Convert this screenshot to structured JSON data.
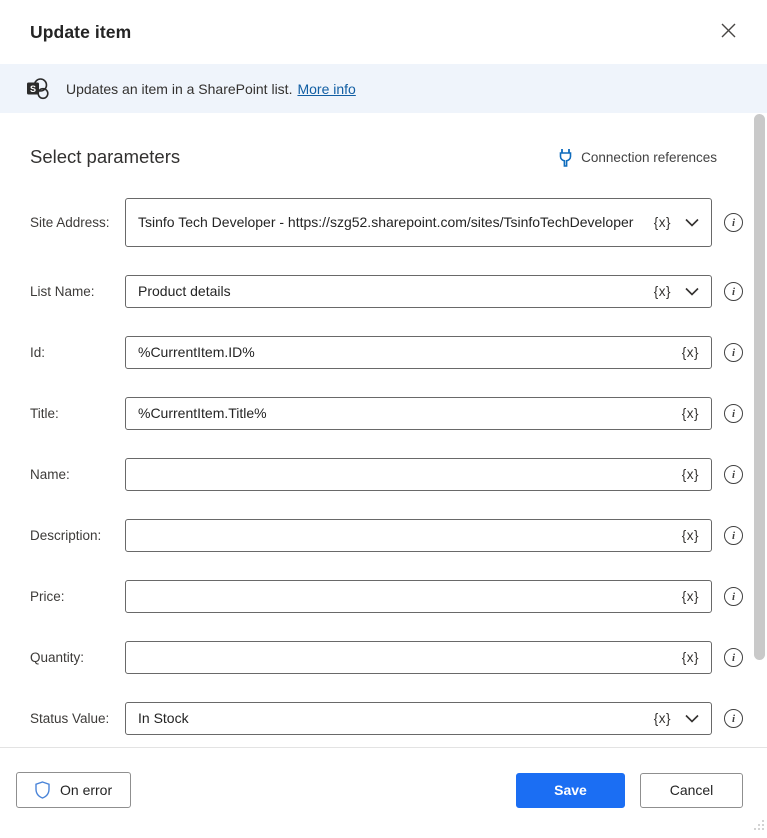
{
  "dialog": {
    "title": "Update item"
  },
  "info_bar": {
    "text": "Updates an item in a SharePoint list.",
    "link_label": "More info",
    "icon": "sharepoint-icon"
  },
  "parameters": {
    "heading": "Select parameters",
    "connection_references_label": "Connection references",
    "connection_references_icon": "plug-icon"
  },
  "variable_token": "{x}",
  "fields": [
    {
      "id": "site-address",
      "label": "Site Address:",
      "value": "Tsinfo Tech Developer - https://szg52.sharepoint.com/sites/TsinfoTechDeveloper",
      "has_dropdown": true,
      "multiline": true
    },
    {
      "id": "list-name",
      "label": "List Name:",
      "value": "Product details",
      "has_dropdown": true,
      "multiline": false
    },
    {
      "id": "id",
      "label": "Id:",
      "value": "%CurrentItem.ID%",
      "has_dropdown": false,
      "multiline": false
    },
    {
      "id": "title",
      "label": "Title:",
      "value": "%CurrentItem.Title%",
      "has_dropdown": false,
      "multiline": false
    },
    {
      "id": "name",
      "label": "Name:",
      "value": "",
      "has_dropdown": false,
      "multiline": false
    },
    {
      "id": "description",
      "label": "Description:",
      "value": "",
      "has_dropdown": false,
      "multiline": false
    },
    {
      "id": "price",
      "label": "Price:",
      "value": "",
      "has_dropdown": false,
      "multiline": false
    },
    {
      "id": "quantity",
      "label": "Quantity:",
      "value": "",
      "has_dropdown": false,
      "multiline": false
    },
    {
      "id": "status-value",
      "label": "Status Value:",
      "value": "In Stock",
      "has_dropdown": true,
      "multiline": false
    }
  ],
  "footer": {
    "on_error_label": "On error",
    "save_label": "Save",
    "cancel_label": "Cancel"
  },
  "colors": {
    "accent_blue": "#1b6ef3",
    "link_blue": "#115ea3",
    "info_bar_bg": "#eff4fb",
    "input_border": "#696969"
  }
}
